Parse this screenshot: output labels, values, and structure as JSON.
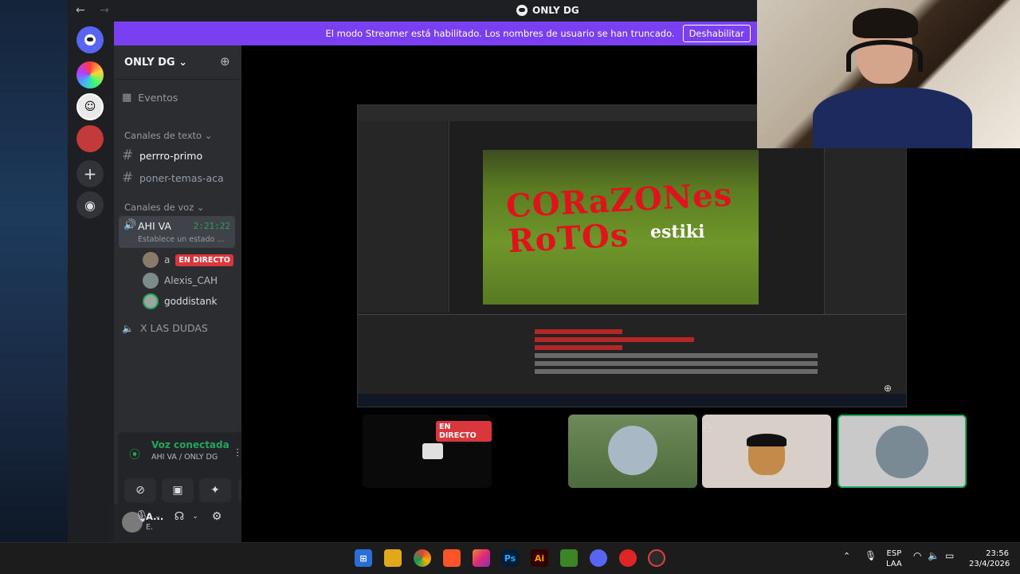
{
  "window": {
    "title": "ONLY DG",
    "back_icon": "←",
    "forward_icon": "→"
  },
  "banner": {
    "text": "El modo Streamer está habilitado. Los nombres de usuario se han truncado.",
    "button": "Deshabilitar",
    "color": "#7b3ff2"
  },
  "server": {
    "name": "ONLY DG ⌄"
  },
  "channels": {
    "events": "Eventos",
    "text_category": "Canales de texto ⌄",
    "text": [
      "perrro-primo",
      "poner-temas-aca"
    ],
    "voice_category": "Canales de voz ⌄",
    "voice_active": {
      "name": "AHI VA",
      "time": "2:21:22",
      "status": "Establece un estado ..."
    },
    "voice_users": [
      {
        "name": "a",
        "badge": "EN DIRECTO"
      },
      {
        "name": "Alexis_CAH"
      },
      {
        "name": "goddistank"
      }
    ],
    "voice_other": "X LAS DUDAS"
  },
  "voice_panel": {
    "title": "Voz conectada",
    "subtitle": "AHI VA / ONLY DG"
  },
  "user_panel": {
    "name": "A...",
    "status": "E."
  },
  "stream": {
    "comp_title": "CORaZONes\nRoTOs",
    "comp_sub": "estiki",
    "live_badge": "EN DIRECTO"
  },
  "taskbar": {
    "lang": "ESP",
    "lang2": "LAA",
    "time": "23:56",
    "date": "23/4/2026",
    "apps": [
      "Ps",
      "Ai"
    ]
  },
  "colors": {
    "accent": "#7b3ff2",
    "live": "#da373c",
    "voice_green": "#23a55a"
  }
}
